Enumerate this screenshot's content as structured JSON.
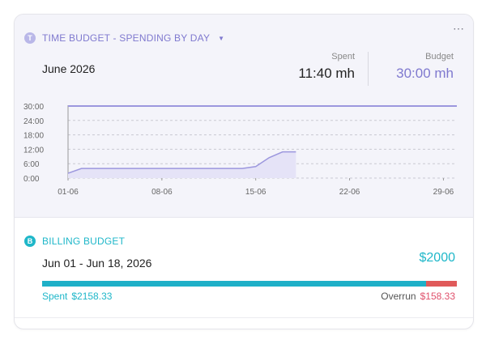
{
  "time_budget": {
    "badge": "T",
    "title": "TIME BUDGET - SPENDING BY DAY",
    "period": "June 2026",
    "spent_label": "Spent",
    "spent_value": "11:40 mh",
    "budget_label": "Budget",
    "budget_value": "30:00 mh"
  },
  "chart_data": {
    "type": "area",
    "x_ticks": [
      "01-06",
      "08-06",
      "15-06",
      "22-06",
      "29-06"
    ],
    "x_tick_days": [
      1,
      8,
      15,
      22,
      29
    ],
    "y_ticks": [
      "30:00",
      "24:00",
      "18:00",
      "12:00",
      "6:00",
      "0:00"
    ],
    "y_tick_values": [
      30,
      24,
      18,
      12,
      6,
      0
    ],
    "ylim": [
      0,
      30
    ],
    "xlim": [
      1,
      30
    ],
    "budget_line": 30,
    "series": [
      {
        "days": [
          1,
          2,
          3,
          4,
          5,
          6,
          7,
          8,
          9,
          10,
          11,
          12,
          13,
          14,
          15,
          16,
          17,
          18
        ],
        "values": [
          2,
          4,
          4,
          4,
          4,
          4,
          4,
          4,
          4,
          4,
          4,
          4,
          4,
          4,
          4.8,
          8.5,
          10.9,
          10.9
        ]
      }
    ],
    "colors": {
      "line": "#9c97de",
      "fill": "#e5e3f7",
      "budget": "#9c97de",
      "grid": "#c9c9d2"
    }
  },
  "billing_budget": {
    "badge": "B",
    "title": "BILLING BUDGET",
    "period": "Jun 01 - Jun 18, 2026",
    "amount": "$2000",
    "spent_label": "Spent",
    "spent_value": "$2158.33",
    "overrun_label": "Overrun",
    "overrun_value": "$158.33",
    "spent_fraction": 0.9267,
    "overrun_fraction": 0.0733
  },
  "more_icon": "⋯"
}
